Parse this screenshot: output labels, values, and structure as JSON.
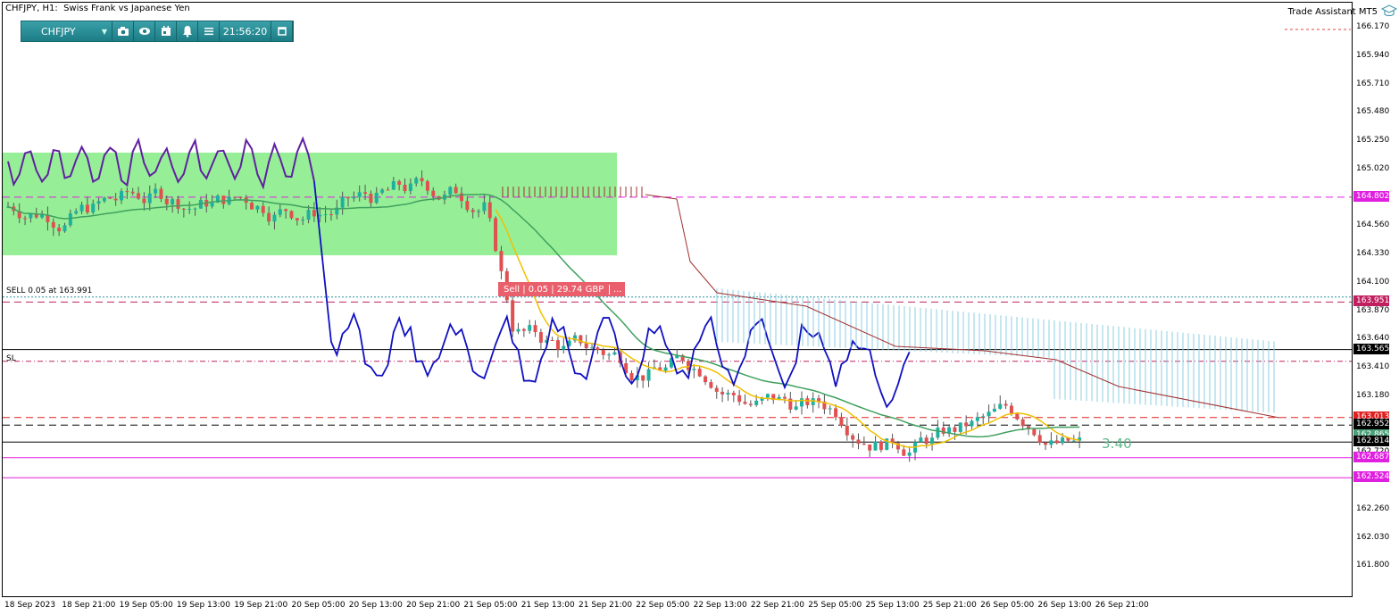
{
  "window": {
    "title": "CHFJPY, H1:  Swiss Frank vs Japanese Yen"
  },
  "toolbar": {
    "symbol": "CHFJPY",
    "time": "21:56:20",
    "buttons": [
      "camera-icon",
      "eye-icon",
      "calendar-icon",
      "bell-icon",
      "menu-icon",
      "window-icon"
    ]
  },
  "trade_assistant": {
    "label": "Trade Assistant MT5"
  },
  "price_axis": {
    "labels": [
      "166.170",
      "165.940",
      "165.710",
      "165.480",
      "165.250",
      "165.020",
      "164.790",
      "164.560",
      "164.330",
      "164.100",
      "163.870",
      "163.640",
      "163.410",
      "163.180",
      "162.950",
      "162.720",
      "162.490",
      "162.260",
      "162.030",
      "161.800"
    ]
  },
  "price_tags": [
    {
      "value": "164.802",
      "color": "#e020e0"
    },
    {
      "value": "163.951",
      "color": "#c02060"
    },
    {
      "value": "163.565",
      "color": "#000000"
    },
    {
      "value": "163.013",
      "color": "#e02020"
    },
    {
      "value": "162.952",
      "color": "#000000"
    },
    {
      "value": "162.865",
      "color": "#4aa078"
    },
    {
      "value": "162.814",
      "color": "#000000"
    },
    {
      "value": "162.687",
      "color": "#e020e0"
    },
    {
      "value": "162.524",
      "color": "#e020e0"
    }
  ],
  "time_axis": {
    "labels": [
      "18 Sep 2023",
      "18 Sep 21:00",
      "19 Sep 05:00",
      "19 Sep 13:00",
      "19 Sep 21:00",
      "20 Sep 05:00",
      "20 Sep 13:00",
      "20 Sep 21:00",
      "21 Sep 05:00",
      "21 Sep 13:00",
      "21 Sep 21:00",
      "22 Sep 05:00",
      "22 Sep 13:00",
      "22 Sep 21:00",
      "25 Sep 05:00",
      "25 Sep 13:00",
      "25 Sep 21:00",
      "26 Sep 05:00",
      "26 Sep 13:00",
      "26 Sep 21:00"
    ]
  },
  "trade": {
    "sell_line_label": "SELL 0.05 at 163.991",
    "sl_label": "SL",
    "popup_text": "Sell | 0.05 | 29.74 GBP",
    "popup_more": "...",
    "timer": "3:40"
  },
  "colors": {
    "range_box": "#90ee90",
    "bull_candle": "#20b0a0",
    "bear_candle": "#e05050",
    "blue_line": "#1010c0",
    "purple_line": "#6020a0",
    "yellow_line": "#f0c000",
    "green_line": "#40a060",
    "cloud_blue": "#8ccfe0",
    "cloud_brown": "#a03030"
  }
}
